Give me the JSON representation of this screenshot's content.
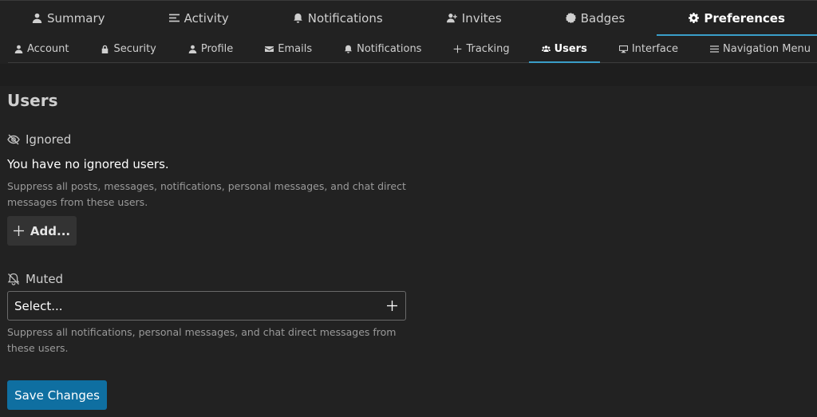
{
  "primary_nav": {
    "items": [
      {
        "label": "Summary",
        "icon": "user-icon"
      },
      {
        "label": "Activity",
        "icon": "list-icon"
      },
      {
        "label": "Notifications",
        "icon": "bell-icon"
      },
      {
        "label": "Invites",
        "icon": "user-plus-icon"
      },
      {
        "label": "Badges",
        "icon": "badge-icon"
      },
      {
        "label": "Preferences",
        "icon": "gear-icon",
        "active": true
      }
    ]
  },
  "secondary_nav": {
    "items": [
      {
        "label": "Account",
        "icon": "user-icon"
      },
      {
        "label": "Security",
        "icon": "lock-icon"
      },
      {
        "label": "Profile",
        "icon": "user-icon"
      },
      {
        "label": "Emails",
        "icon": "envelope-icon"
      },
      {
        "label": "Notifications",
        "icon": "bell-icon"
      },
      {
        "label": "Tracking",
        "icon": "plus-icon"
      },
      {
        "label": "Users",
        "icon": "users-icon",
        "active": true
      },
      {
        "label": "Interface",
        "icon": "desktop-icon"
      },
      {
        "label": "Navigation Menu",
        "icon": "bars-icon"
      }
    ]
  },
  "main": {
    "title": "Users",
    "ignored": {
      "label": "Ignored",
      "icon": "eye-slash-icon",
      "empty_text": "You have no ignored users.",
      "help": "Suppress all posts, messages, notifications, personal messages, and chat direct messages from these users.",
      "add_label": "Add..."
    },
    "muted": {
      "label": "Muted",
      "icon": "bell-slash-icon",
      "select_placeholder": "Select...",
      "help": "Suppress all notifications, personal messages, and chat direct messages from these users."
    },
    "save_label": "Save Changes"
  },
  "colors": {
    "background": "#222222",
    "accent": "#3a9ec9",
    "primary_button": "#0f6fa1"
  }
}
